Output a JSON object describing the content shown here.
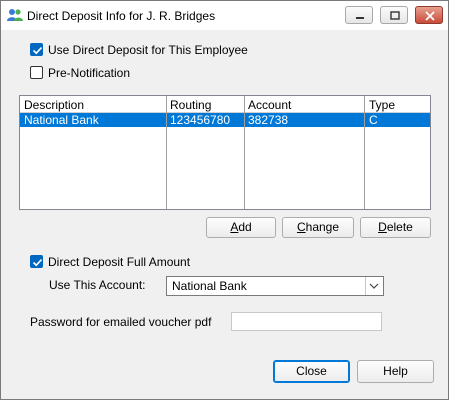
{
  "window": {
    "title": "Direct Deposit Info for J. R. Bridges",
    "icon": "users-icon"
  },
  "checks": {
    "use_direct_deposit": {
      "label": "Use Direct Deposit for This Employee",
      "checked": true
    },
    "pre_notification": {
      "label": "Pre-Notification",
      "checked": false
    },
    "full_amount": {
      "label": "Direct Deposit Full Amount",
      "checked": true
    }
  },
  "accounts_table": {
    "headers": [
      "Description",
      "Routing",
      "Account",
      "Type"
    ],
    "rows": [
      {
        "description": "National Bank",
        "routing": "123456780",
        "account": "382738",
        "type": "C",
        "selected": true
      }
    ]
  },
  "buttons": {
    "add": {
      "pre": "",
      "mnemonic": "A",
      "post": "dd"
    },
    "change": {
      "pre": "",
      "mnemonic": "C",
      "post": "hange"
    },
    "delete": {
      "pre": "",
      "mnemonic": "D",
      "post": "elete"
    },
    "close": "Close",
    "help": "Help"
  },
  "account_select": {
    "label": "Use This Account:",
    "value": "National Bank"
  },
  "password": {
    "label": "Password for emailed voucher pdf",
    "value": ""
  },
  "colors": {
    "selection": "#0078d7",
    "check_fill": "#0067c0"
  }
}
